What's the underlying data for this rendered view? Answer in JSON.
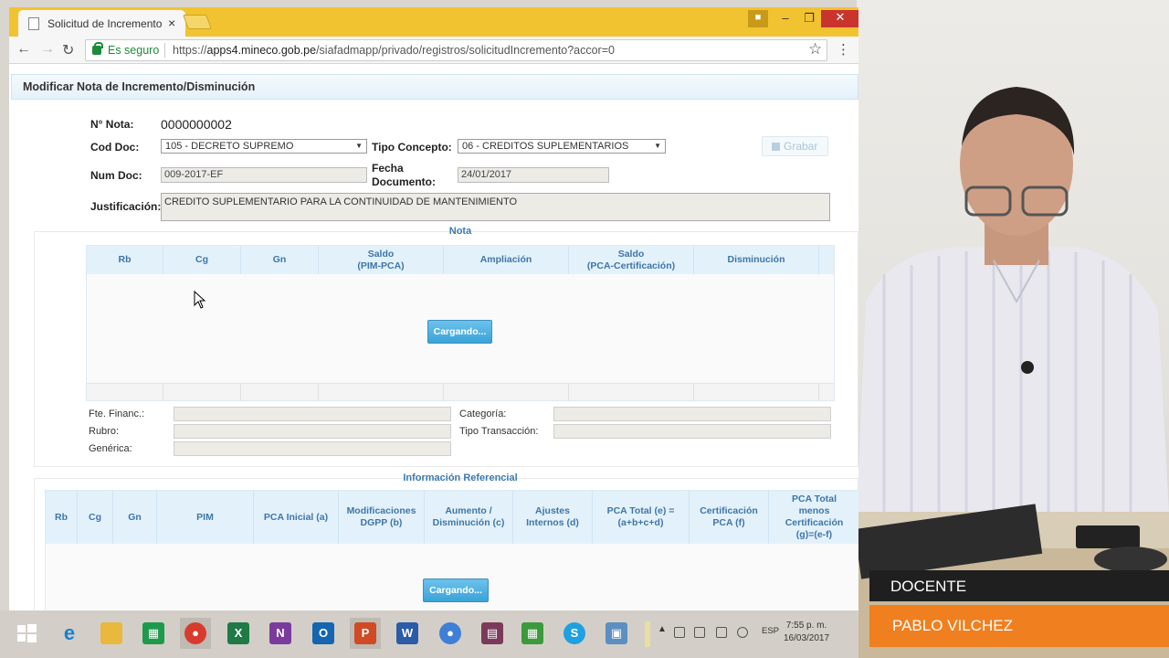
{
  "browser": {
    "tab_title": "Solicitud de Incremento",
    "tab_close": "×",
    "secure_label": "Es seguro",
    "url_prefix": "https://",
    "url_host": "apps4.mineco.gob.pe",
    "url_path": "/siafadmapp/privado/registros/solicitudIncremento?accor=0"
  },
  "page": {
    "header": "Modificar Nota de Incremento/Disminución",
    "form": {
      "nota_label": "N° Nota:",
      "nota_value": "0000000002",
      "cod_doc_label": "Cod Doc:",
      "cod_doc_value": "105 - DECRETO SUPREMO",
      "tipo_concepto_label": "Tipo Concepto:",
      "tipo_concepto_value": "06 - CREDITOS SUPLEMENTARIOS",
      "grabar_label": "Grabar",
      "num_doc_label": "Num Doc:",
      "num_doc_value": "009-2017-EF",
      "fecha_label_1": "Fecha",
      "fecha_label_2": "Documento:",
      "fecha_value": "24/01/2017",
      "justificacion_label": "Justificación:",
      "justificacion_value": "CREDITO SUPLEMENTARIO PARA LA CONTINUIDAD DE MANTENIMIENTO"
    },
    "nota_panel": {
      "title": "Nota",
      "columns": [
        "Rb",
        "Cg",
        "Gn",
        "Saldo\n(PIM-PCA)",
        "Ampliación",
        "Saldo\n(PCA-Certificación)",
        "Disminución"
      ],
      "loading": "Cargando...",
      "fte_financ_label": "Fte. Financ.:",
      "rubro_label": "Rubro:",
      "generica_label": "Genérica:",
      "categoria_label": "Categoría:",
      "tipo_transaccion_label": "Tipo Transacción:"
    },
    "info_panel": {
      "title": "Información Referencial",
      "columns": [
        "Rb",
        "Cg",
        "Gn",
        "PIM",
        "PCA Inicial (a)",
        "Modificaciones\nDGPP (b)",
        "Aumento /\nDisminución (c)",
        "Ajustes\nInternos (d)",
        "PCA Total (e) =\n(a+b+c+d)",
        "Certificación\nPCA (f)",
        "PCA Total\nmenos\nCertificación\n(g)=(e-f)"
      ],
      "loading": "Cargando..."
    }
  },
  "taskbar": {
    "apps": [
      "windows-start",
      "internet-explorer",
      "file-explorer",
      "sheets",
      "chrome",
      "excel",
      "onenote",
      "outlook",
      "powerpoint",
      "word",
      "chrome-alt",
      "winrar",
      "apps-grid",
      "skype",
      "remote-desktop"
    ],
    "lang": "ESP",
    "time": "7:55 p. m.",
    "date": "16/03/2017"
  },
  "overlay": {
    "name_label": "DOCENTE",
    "title_label": "PABLO VILCHEZ"
  },
  "colors": {
    "tabstrip": "#f2c330",
    "header_blue": "#3e76a8",
    "loading_button": "#3aa3d8",
    "lower_third_orange": "#f07f1f"
  }
}
